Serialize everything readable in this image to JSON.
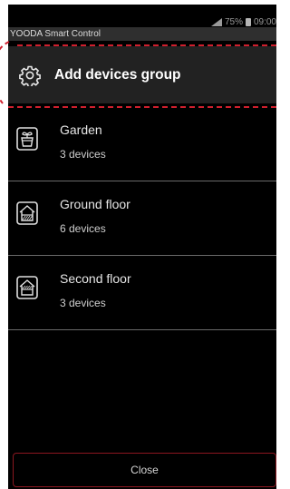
{
  "status_bar": {
    "battery_percent": "75%",
    "time": "09:00"
  },
  "app": {
    "title": "YOODA Smart Control"
  },
  "add_group": {
    "label": "Add devices group",
    "icon": "gear-icon"
  },
  "groups": [
    {
      "name": "Garden",
      "count": "3 devices",
      "icon": "plant-pot-icon"
    },
    {
      "name": "Ground floor",
      "count": "6 devices",
      "icon": "house-icon"
    },
    {
      "name": "Second floor",
      "count": "3 devices",
      "icon": "house-icon"
    }
  ],
  "close_button": {
    "label": "Close"
  },
  "colors": {
    "highlight_dash": "#d01f2d",
    "close_border": "#8c1720",
    "background": "#000000",
    "header_band": "#2f2f2f"
  }
}
